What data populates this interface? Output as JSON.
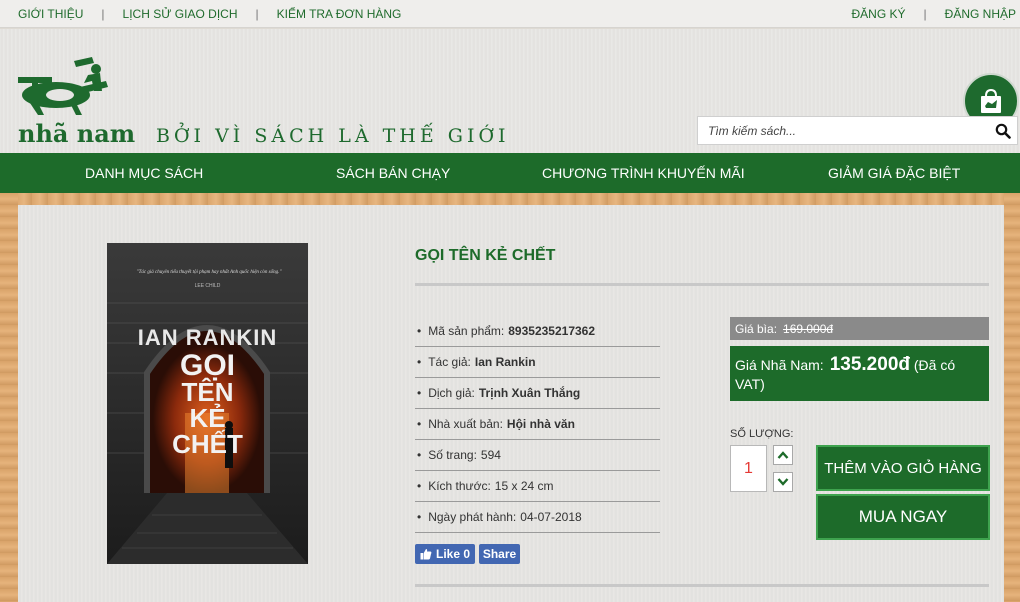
{
  "topbar": {
    "left_links": [
      "GIỚI THIỆU",
      "LỊCH SỬ GIAO DỊCH",
      "KIỂM TRA ĐƠN HÀNG"
    ],
    "right_links": [
      "ĐĂNG KÝ",
      "ĐĂNG NHẬP"
    ],
    "separator": "|"
  },
  "header": {
    "logo_text": "nhã nam",
    "slogan": "BỞI VÌ SÁCH LÀ THẾ GIỚI",
    "cart_icon": "shopping-bag-icon",
    "search": {
      "placeholder": "Tìm kiếm sách...",
      "icon": "search-icon"
    }
  },
  "nav": {
    "items": [
      "DANH MỤC SÁCH",
      "SÁCH BÁN CHẠY",
      "CHƯƠNG TRÌNH KHUYẾN MÃI",
      "GIẢM GIÁ ĐẶC BIỆT"
    ]
  },
  "product": {
    "title": "GỌI TÊN KẺ CHẾT",
    "cover": {
      "quote": "\"Tác giả chuyên tiểu thuyết tội phạm hay nhất Anh quốc hiện còn sống.\"",
      "quote_author": "LEE CHILD",
      "author_line": "IAN RANKIN",
      "title_lines": [
        "GỌI",
        "TÊN",
        "KẺ",
        "CHẾT"
      ]
    },
    "info": [
      {
        "label": "Mã sản phẩm:",
        "value": "8935235217362",
        "bold": true
      },
      {
        "label": "Tác giả:",
        "value": "Ian Rankin",
        "bold": true
      },
      {
        "label": "Dịch giả:",
        "value": "Trịnh Xuân Thắng",
        "bold": true
      },
      {
        "label": "Nhà xuất bản:",
        "value": "Hội nhà văn",
        "bold": true
      },
      {
        "label": "Số trang:",
        "value": "594",
        "bold": false
      },
      {
        "label": "Kích thước:",
        "value": "15 x 24 cm",
        "bold": false
      },
      {
        "label": "Ngày phát hành:",
        "value": "04-07-2018",
        "bold": false
      }
    ],
    "social": {
      "like_label": "Like 0",
      "share_label": "Share"
    },
    "price": {
      "cover_label": "Giá bìa:",
      "cover_price": "169.000đ",
      "nn_label": "Giá Nhã Nam:",
      "nn_price": "135.200đ",
      "vat_note": "(Đã có VAT)"
    },
    "quantity": {
      "label": "SỐ LƯỢNG:",
      "value": "1"
    },
    "buttons": {
      "add_to_cart": "THÊM VÀO GIỎ HÀNG",
      "buy_now": "MUA NGAY"
    }
  },
  "colors": {
    "brand_green": "#1d6b2a",
    "link_green": "#1f6b2c",
    "facebook_blue": "#4267b2",
    "qty_red": "#e53935"
  }
}
